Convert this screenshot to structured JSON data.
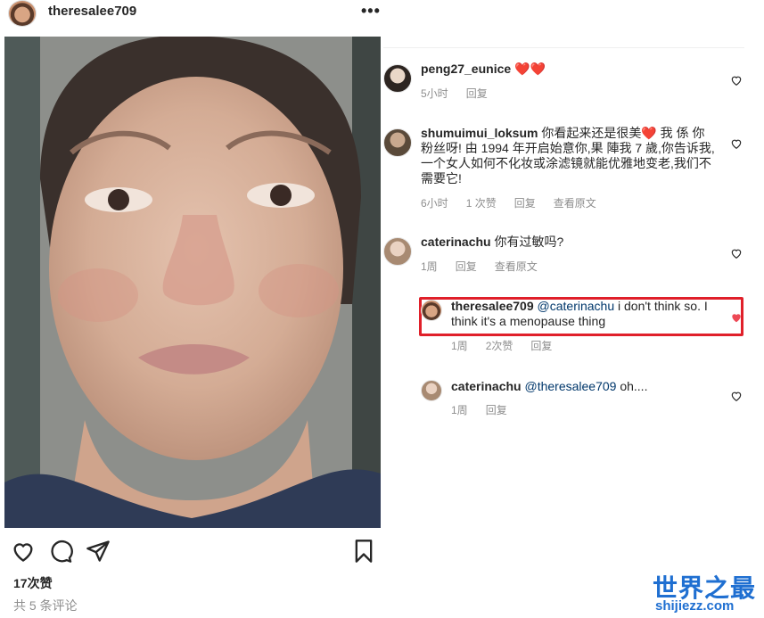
{
  "post": {
    "username": "theresalee709",
    "likes": "17次赞",
    "comments_count": "共 5 条评论"
  },
  "icons": {
    "more": "more-options-icon",
    "like": "heart-outline-icon",
    "comment": "comment-bubble-icon",
    "share": "paper-plane-icon",
    "save": "bookmark-icon"
  },
  "comments": [
    {
      "user": "peng27_eunice",
      "text": "❤️❤️",
      "meta": [
        "5小时",
        "回复"
      ]
    },
    {
      "user": "shumuimui_loksum",
      "text": "你看起来还是很美❤️ 我 係 你粉丝呀! 由 1994 年开启始意你,果 陣我 7 歲,你告诉我,一个女人如何不化妆或涂滤镜就能优雅地变老,我们不需要它!",
      "meta": [
        "6小时",
        "1 次赞",
        "回复",
        "查看原文"
      ]
    },
    {
      "user": "caterinachu",
      "text": "你有过敏吗?",
      "meta": [
        "1周",
        "回复",
        "查看原文"
      ]
    },
    {
      "user": "theresalee709",
      "mention": "@caterinachu",
      "text": "i don't think so. I think it's a menopause thing",
      "meta": [
        "1周",
        "2次赞",
        "回复"
      ]
    },
    {
      "user": "caterinachu",
      "mention": "@theresalee709",
      "text": "oh....",
      "meta": [
        "1周",
        "回复"
      ]
    }
  ],
  "watermark": {
    "title": "世界之最",
    "url": "shijiezz.com"
  },
  "colors": {
    "highlight": "#e0202a",
    "liked_heart": "#ed4956",
    "watermark": "#1f6fd1"
  }
}
